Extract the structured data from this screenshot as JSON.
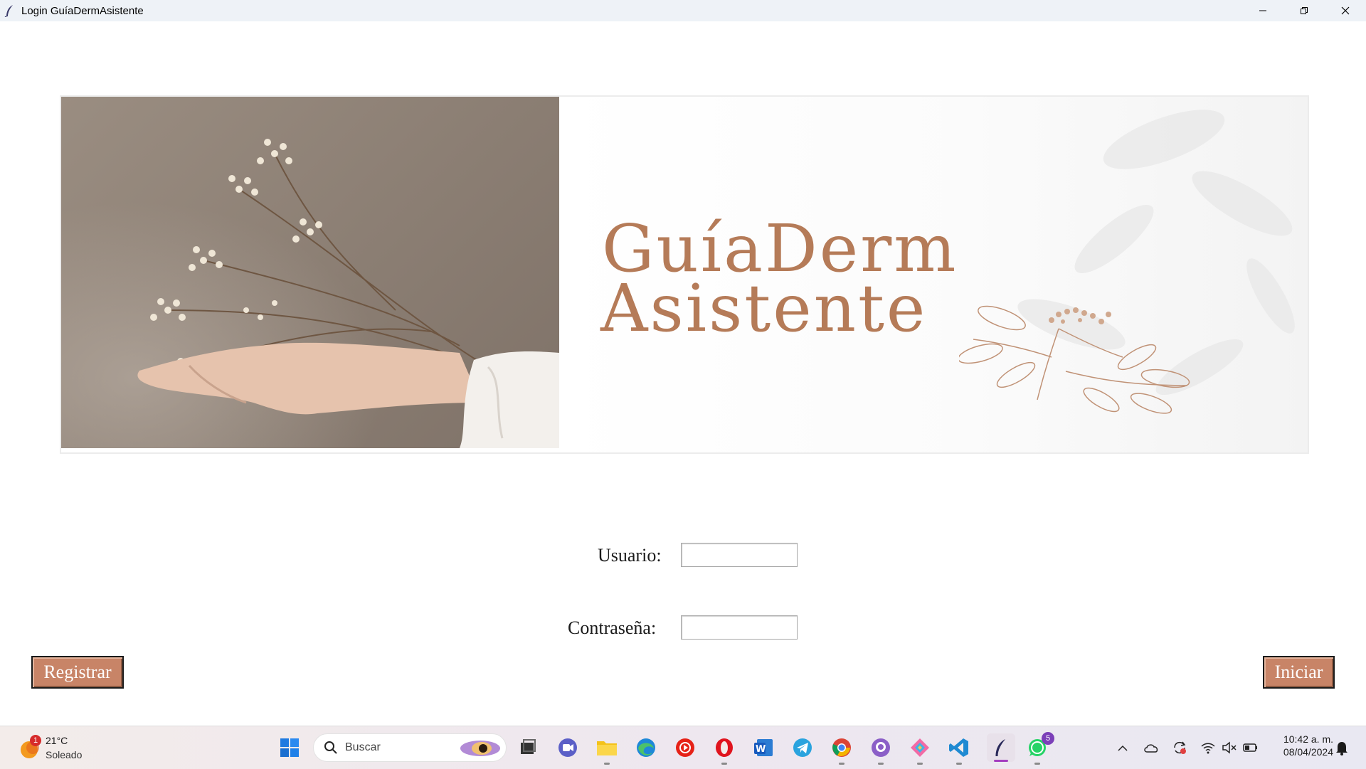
{
  "window": {
    "title": "Login GuíaDermAsistente"
  },
  "banner": {
    "line1": "GuíaDerm",
    "line2": "Asistente",
    "brand_color": "#b57b58"
  },
  "form": {
    "user_label": "Usuario:",
    "user_value": "",
    "password_label": "Contraseña:",
    "password_value": ""
  },
  "buttons": {
    "register": "Registrar",
    "login": "Iniciar",
    "color": "#c88467"
  },
  "taskbar": {
    "weather_badge": "1",
    "weather_temp": "21°C",
    "weather_desc": "Soleado",
    "search_placeholder": "Buscar",
    "whatsapp_badge": "5",
    "time": "10:42 a. m.",
    "date": "08/04/2024",
    "apps": [
      "windows-start",
      "search",
      "task-view",
      "zoom",
      "file-explorer",
      "edge",
      "youtube-music",
      "opera",
      "word",
      "telegram",
      "chrome",
      "github-desktop",
      "git-kraken",
      "vscode",
      "feather-app",
      "whatsapp"
    ]
  }
}
